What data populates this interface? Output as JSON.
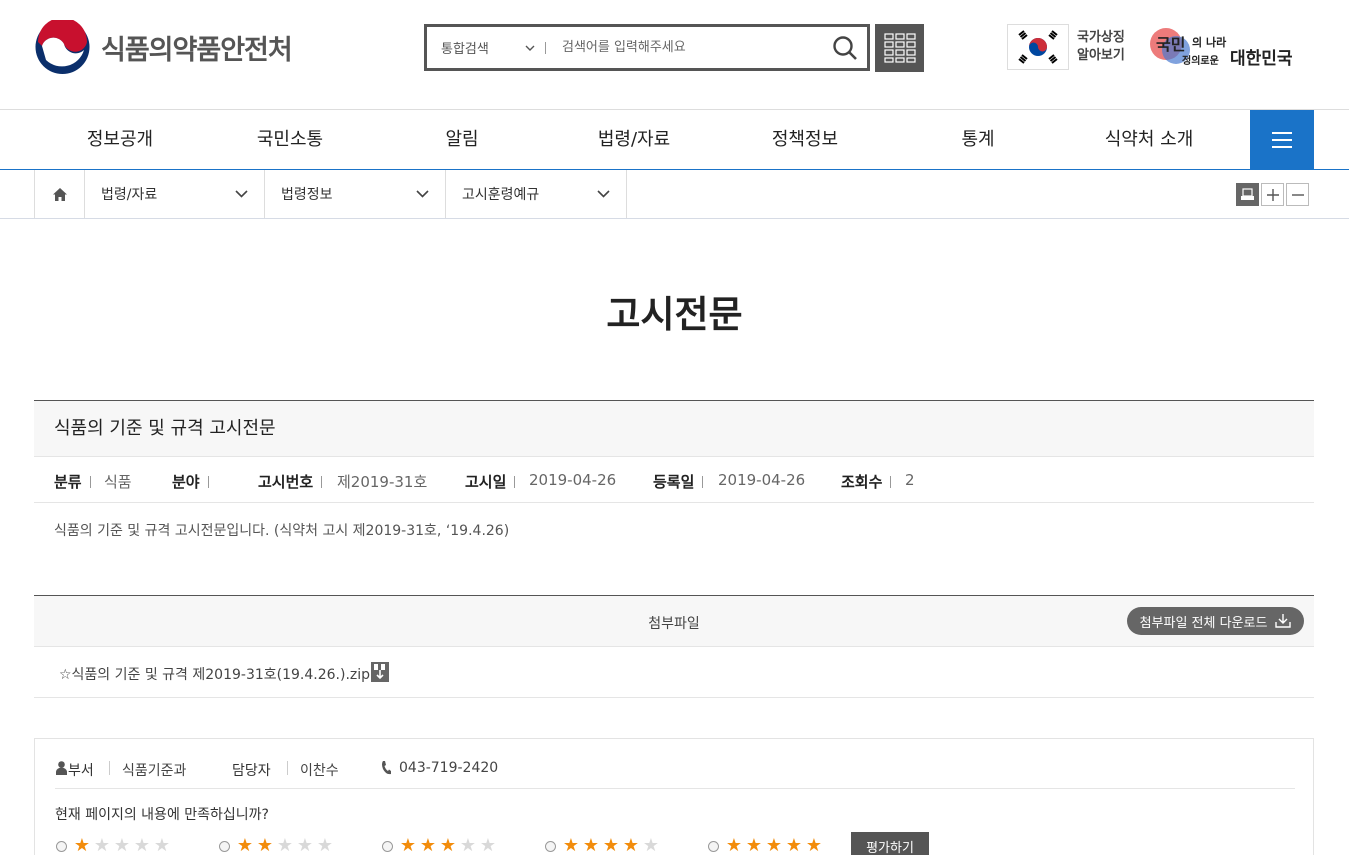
{
  "header": {
    "logo_text": "식품의약품안전처",
    "search": {
      "select_value": "통합검색",
      "placeholder": "검색어를 입력해주세요"
    },
    "national_symbol": "국가상징 알아보기",
    "slogan_alt": "국민의 나라 정의로운 대한민국"
  },
  "gnb": {
    "items": [
      "정보공개",
      "국민소통",
      "알림",
      "법령/자료",
      "정책정보",
      "통계",
      "식약처 소개"
    ]
  },
  "location": {
    "items": [
      "법령/자료",
      "법령정보",
      "고시훈령예규"
    ]
  },
  "page": {
    "title": "고시전문"
  },
  "article": {
    "title": "식품의 기준 및 규격 고시전문",
    "meta": {
      "category_label": "분류",
      "category_value": "식품",
      "field_label": "분야",
      "field_value": "",
      "number_label": "고시번호",
      "number_value": "제2019-31호",
      "date_label": "고시일",
      "date_value": "2019-04-26",
      "reg_label": "등록일",
      "reg_value": "2019-04-26",
      "views_label": "조회수",
      "views_value": "2"
    },
    "description": "식품의 기준 및 규격 고시전문입니다. (식약처 고시 제2019-31호, ‘19.4.26)"
  },
  "attachments": {
    "title": "첨부파일",
    "download_all": "첨부파일 전체 다운로드",
    "files": [
      "☆식품의 기준 및 규격 제2019-31호(19.4.26.).zip"
    ]
  },
  "feedback": {
    "dept_label": "부서",
    "dept_value": "식품기준과",
    "manager_label": "담당자",
    "manager_value": "이찬수",
    "phone": "043-719-2420",
    "question": "현재 페이지의 내용에 만족하십니까?",
    "ratings": [
      1,
      2,
      3,
      4,
      5
    ],
    "submit": "평가하기"
  },
  "colors": {
    "primary_blue": "#1a73c8",
    "star_orange": "#f28c0c",
    "dark_gray": "#555555"
  }
}
